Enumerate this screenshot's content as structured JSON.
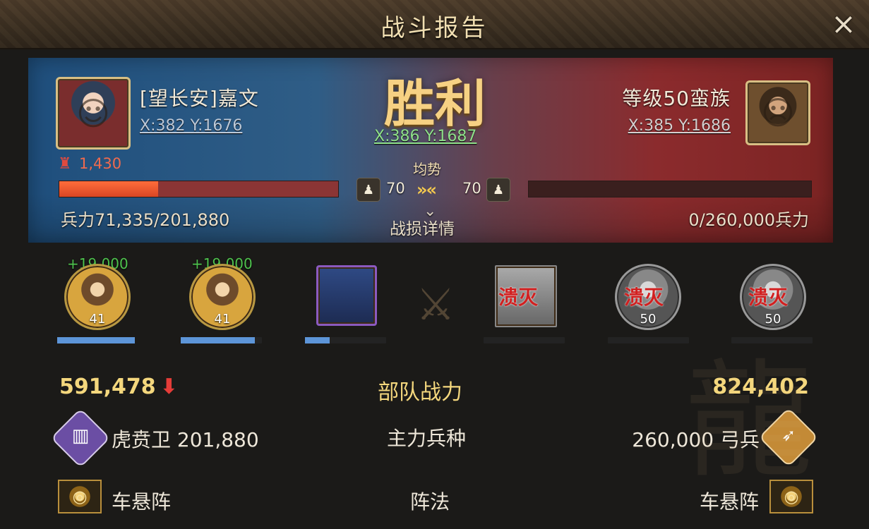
{
  "title": "战斗报告",
  "close_icon": "×",
  "player": {
    "name": "[望长安]嘉文",
    "coord": "X:382 Y:1676",
    "losses": "1,430",
    "troops": "兵力71,335/201,880"
  },
  "enemy": {
    "name": "等级50蛮族",
    "coord": "X:385 Y:1686",
    "troops": "0/260,000兵力"
  },
  "center": {
    "result": "胜利",
    "coord": "X:386 Y:1687",
    "trend": "均势",
    "left_value": "70",
    "right_value": "70",
    "details": "战损详情"
  },
  "units": {
    "gain1": "+19,000",
    "gain2": "+19,000",
    "level1": "41",
    "level2": "41",
    "ko": "溃灭",
    "level3": "50",
    "level4": "50"
  },
  "summary": {
    "power_label": "部队战力",
    "power_left": "591,478",
    "power_right": "824,402",
    "main_troop_label": "主力兵种",
    "left_troop": "虎贲卫 201,880",
    "right_troop": "260,000 弓兵",
    "formation_label": "阵法",
    "left_formation": "车悬阵",
    "right_formation": "车悬阵"
  }
}
